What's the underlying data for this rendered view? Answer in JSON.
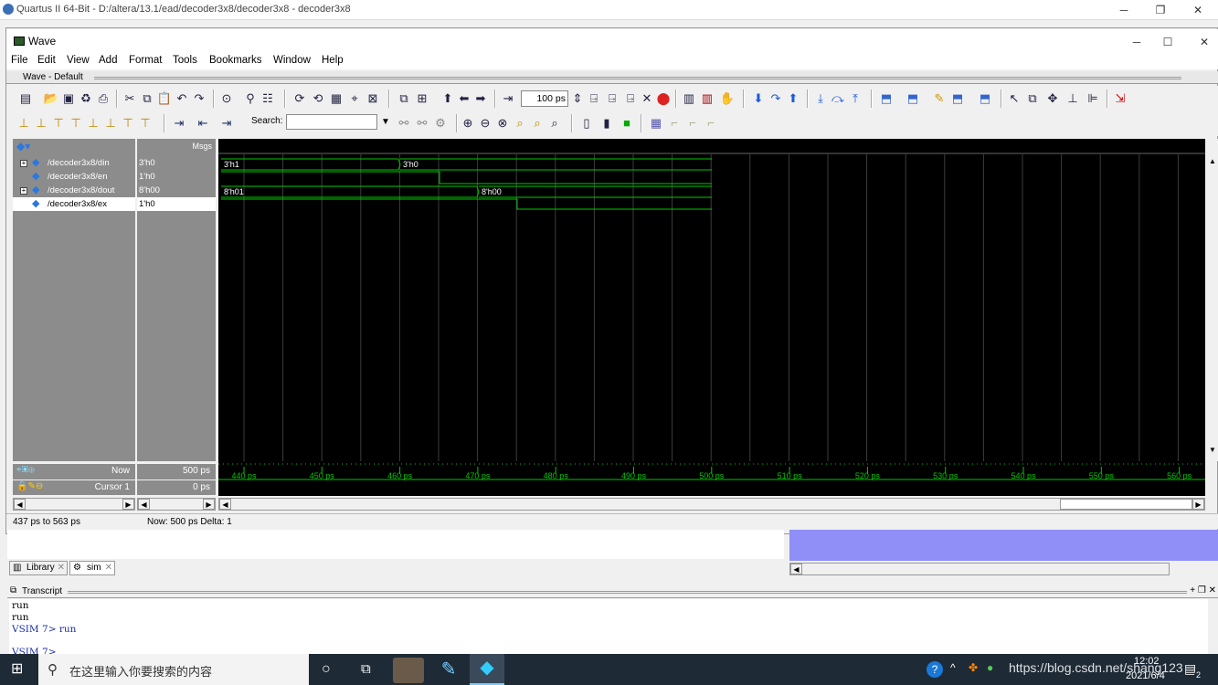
{
  "app": {
    "quartus_title": "Quartus II 64-Bit - D:/altera/13.1/ead/decoder3x8/decoder3x8 - decoder3x8",
    "wave_title": "Wave",
    "subwindow_title": "Wave - Default"
  },
  "menu": [
    "File",
    "Edit",
    "View",
    "Add",
    "Format",
    "Tools",
    "Bookmarks",
    "Window",
    "Help"
  ],
  "toolbar": {
    "zoom_value": "100 ps",
    "search_label": "Search:",
    "search_value": ""
  },
  "headers": {
    "msgs": "Msgs"
  },
  "signals": [
    {
      "name": "/decoder3x8/din",
      "value": "3'h0",
      "expandable": true
    },
    {
      "name": "/decoder3x8/en",
      "value": "1'h0",
      "expandable": false
    },
    {
      "name": "/decoder3x8/dout",
      "value": "8'h00",
      "expandable": true
    },
    {
      "name": "/decoder3x8/ex",
      "value": "1'h0",
      "expandable": false,
      "selected": true
    }
  ],
  "wave_labels": {
    "din_a": "3'h1",
    "din_b": "3'h0",
    "dout_a": "8'h01",
    "dout_b": "8'h00"
  },
  "now_row": {
    "label": "Now",
    "value": "500 ps"
  },
  "cursor_row": {
    "label": "Cursor 1",
    "value": "0 ps"
  },
  "time_ticks": [
    "440 ps",
    "450 ps",
    "460 ps",
    "470 ps",
    "480 ps",
    "490 ps",
    "500 ps",
    "510 ps",
    "520 ps",
    "530 ps",
    "540 ps",
    "550 ps",
    "560 ps"
  ],
  "status": {
    "range": "437 ps to 563 ps",
    "now": "Now: 500 ps  Delta: 1"
  },
  "tabs": [
    {
      "label": "Library"
    },
    {
      "label": "sim"
    }
  ],
  "transcript": {
    "title": "Transcript",
    "lines": [
      "run",
      "run",
      "VSIM 7> run",
      "VSIM 7>"
    ]
  },
  "taskbar": {
    "search_placeholder": "在这里输入你要搜索的内容",
    "watermark": "https://blog.csdn.net/shang123",
    "time": "12:02",
    "date": "2021/6/4",
    "badge": "2"
  },
  "colors": {
    "wave_green": "#00c800",
    "pane_gray": "#8c8c8c",
    "taskbar": "#1e2a36"
  }
}
